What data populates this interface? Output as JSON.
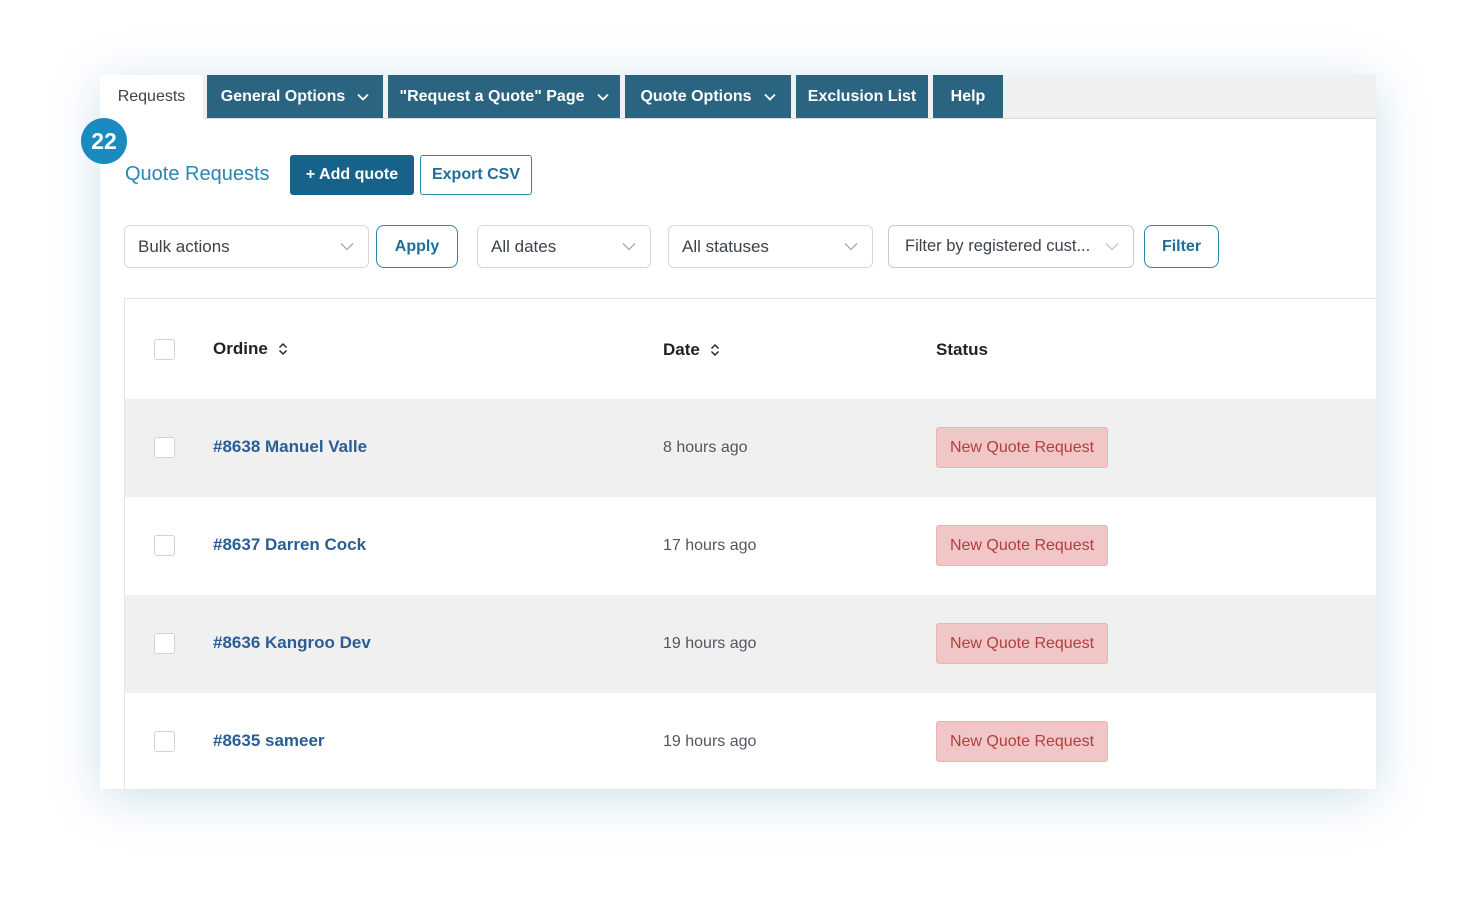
{
  "badge": {
    "number": "22"
  },
  "tabs": {
    "requests": "Requests",
    "general_options": "General Options",
    "request_quote_page": "\"Request a Quote\" Page",
    "quote_options": "Quote Options",
    "exclusion_list": "Exclusion List",
    "help": "Help"
  },
  "header": {
    "title": "Quote Requests",
    "add_quote": "+ Add quote",
    "export_csv": "Export CSV"
  },
  "filters": {
    "bulk_actions": "Bulk actions",
    "apply": "Apply",
    "dates": "All dates",
    "statuses": "All statuses",
    "customer": "Filter by registered cust...",
    "filter": "Filter"
  },
  "table": {
    "columns": {
      "order": "Ordine",
      "date": "Date",
      "status": "Status"
    },
    "rows": [
      {
        "order": "#8638 Manuel Valle",
        "date": "8 hours ago",
        "status": "New Quote Request"
      },
      {
        "order": "#8637 Darren Cock",
        "date": "17 hours ago",
        "status": "New Quote Request"
      },
      {
        "order": "#8636 Kangroo Dev",
        "date": "19 hours ago",
        "status": "New Quote Request"
      },
      {
        "order": "#8635 sameer",
        "date": "19 hours ago",
        "status": "New Quote Request"
      }
    ]
  },
  "colors": {
    "tab_bg": "#2b6481",
    "accent": "#2b86b0",
    "primary_button": "#17628a",
    "status_bg": "#f1c6c6",
    "status_text": "#b13f3f",
    "link": "#2a5e94"
  }
}
